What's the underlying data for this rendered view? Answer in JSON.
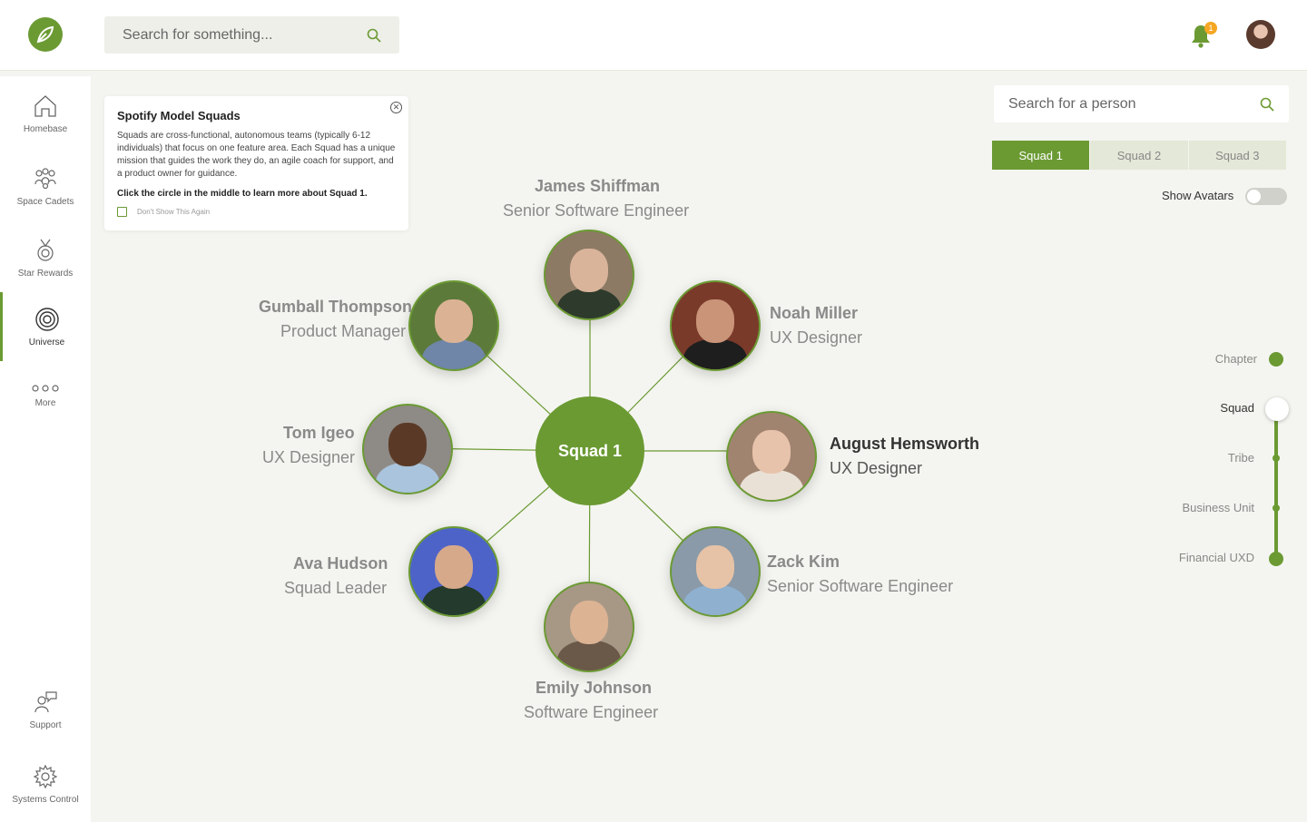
{
  "header": {
    "search_placeholder": "Search for something...",
    "notification_count": "1"
  },
  "sidebar": {
    "items": [
      {
        "label": "Homebase",
        "icon": "home-icon"
      },
      {
        "label": "Space Cadets",
        "icon": "people-icon"
      },
      {
        "label": "Star Rewards",
        "icon": "medal-icon"
      },
      {
        "label": "Universe",
        "icon": "target-icon",
        "active": true
      },
      {
        "label": "More",
        "icon": "more-icon"
      },
      {
        "label": "Support",
        "icon": "support-icon"
      },
      {
        "label": "Systems Control",
        "icon": "gear-icon"
      }
    ]
  },
  "info_card": {
    "title": "Spotify Model Squads",
    "body": "Squads are cross-functional, autonomous teams (typically 6-12 individuals) that focus on one feature area. Each Squad has a unique mission that guides the work they do, an agile coach for support, and a product owner for guidance.",
    "cta": "Click the circle in the middle to learn more about Squad 1.",
    "dont_show": "Don't Show This Again"
  },
  "graph": {
    "center_label": "Squad 1",
    "members": [
      {
        "name": "James Shiffman",
        "role": "Senior Software Engineer"
      },
      {
        "name": "Noah Miller",
        "role": "UX Designer"
      },
      {
        "name": "August Hemsworth",
        "role": "UX Designer",
        "highlighted": true
      },
      {
        "name": "Zack Kim",
        "role": "Senior Software Engineer"
      },
      {
        "name": "Emily Johnson",
        "role": "Software Engineer"
      },
      {
        "name": "Ava Hudson",
        "role": "Squad Leader"
      },
      {
        "name": "Tom Igeo",
        "role": "UX Designer"
      },
      {
        "name": "Gumball Thompson",
        "role": "Product Manager"
      }
    ]
  },
  "right_panel": {
    "search_placeholder": "Search for a person",
    "tabs": [
      "Squad 1",
      "Squad 2",
      "Squad 3"
    ],
    "active_tab": "Squad 1",
    "show_avatars_label": "Show Avatars",
    "show_avatars_on": false,
    "levels": [
      "Chapter",
      "Squad",
      "Tribe",
      "Business Unit",
      "Financial UXD"
    ],
    "active_level": "Squad"
  },
  "colors": {
    "accent": "#6b9a33",
    "badge": "#f5a623",
    "background": "#f4f5f0"
  }
}
